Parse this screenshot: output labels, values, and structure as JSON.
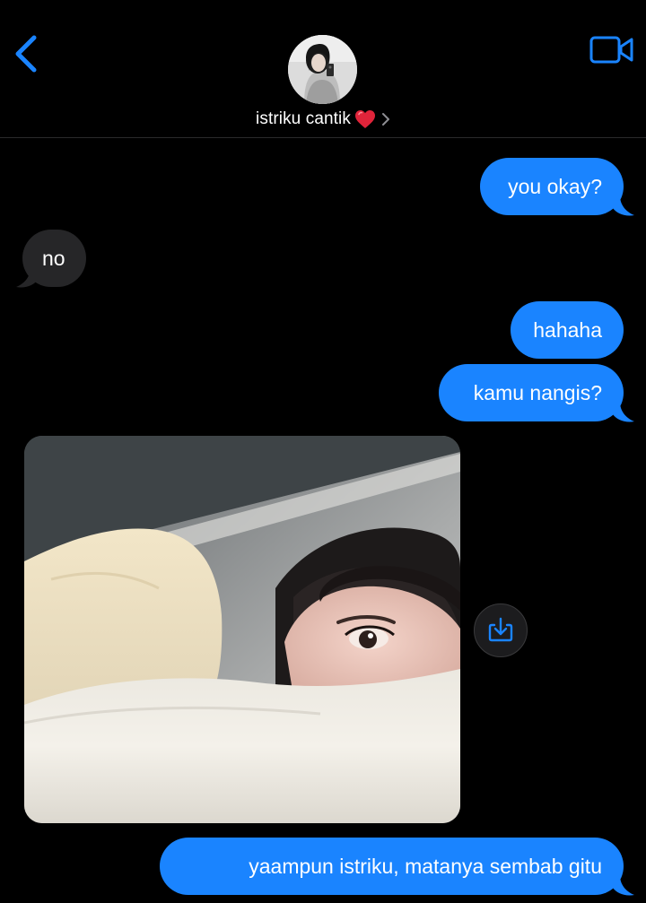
{
  "header": {
    "contact_name": "istriku cantik",
    "back_icon": "chevron-left-icon",
    "video_icon": "video-camera-icon",
    "accent_color": "#1a84ff"
  },
  "messages": [
    {
      "direction": "outgoing",
      "text": "you okay?"
    },
    {
      "direction": "incoming",
      "text": "no"
    },
    {
      "direction": "outgoing",
      "text": "hahaha"
    },
    {
      "direction": "outgoing",
      "text": "kamu nangis?"
    },
    {
      "direction": "incoming",
      "type": "photo"
    },
    {
      "direction": "outgoing",
      "text": "yaampun istriku, matanya sembab gitu"
    }
  ],
  "colors": {
    "background": "#000000",
    "outgoing_bubble": "#1a84ff",
    "incoming_bubble": "#262628"
  }
}
